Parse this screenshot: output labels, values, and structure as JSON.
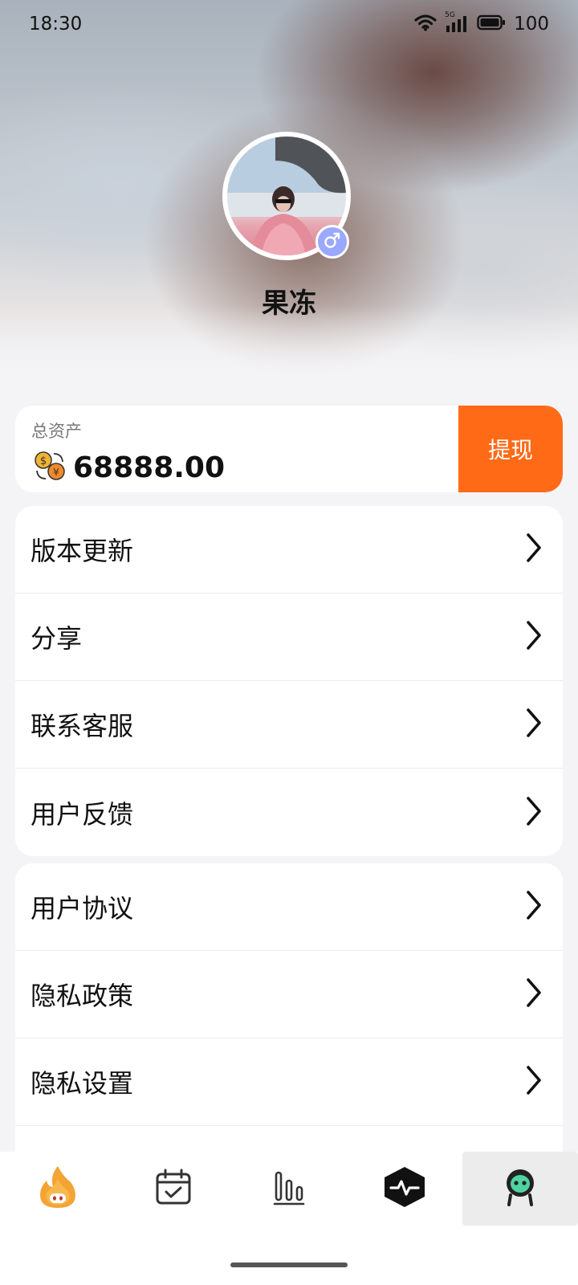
{
  "status_bar": {
    "time": "18:30",
    "network": "5G",
    "battery": "100"
  },
  "profile": {
    "username": "果冻",
    "gender": "male"
  },
  "assets": {
    "label": "总资产",
    "value": "68888.00",
    "withdraw_label": "提现"
  },
  "menu_group_1": [
    {
      "label": "版本更新"
    },
    {
      "label": "分享"
    },
    {
      "label": "联系客服"
    },
    {
      "label": "用户反馈"
    }
  ],
  "menu_group_2": [
    {
      "label": "用户协议"
    },
    {
      "label": "隐私政策"
    },
    {
      "label": "隐私设置"
    }
  ],
  "tab_bar": {
    "tabs": [
      {
        "icon": "flame-mascot-icon"
      },
      {
        "icon": "calendar-check-icon"
      },
      {
        "icon": "bar-chart-icon"
      },
      {
        "icon": "activity-pulse-icon"
      },
      {
        "icon": "robot-avatar-icon",
        "active": true
      }
    ]
  },
  "colors": {
    "accent": "#ff6a17",
    "gender_badge": "#9aa8ff",
    "active_tab_bg": "#ececec"
  }
}
